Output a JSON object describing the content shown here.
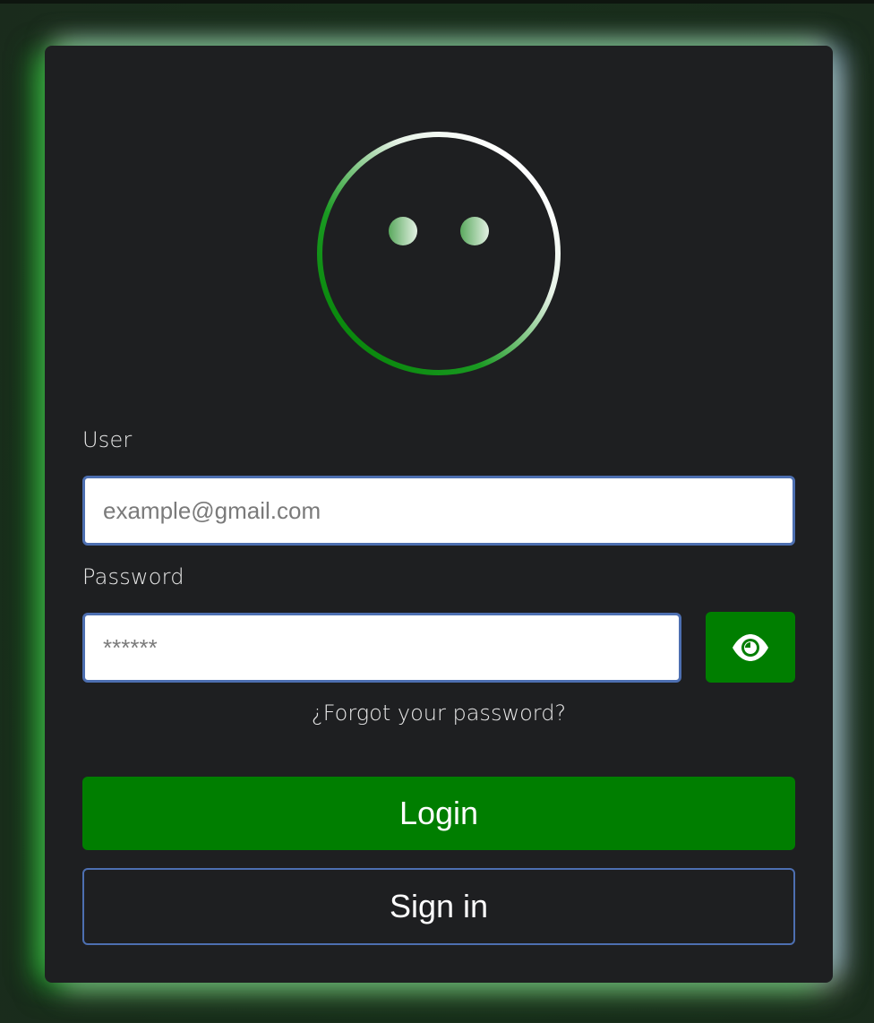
{
  "form": {
    "user_label": "User",
    "user_placeholder": "example@gmail.com",
    "user_value": "",
    "password_label": "Password",
    "password_placeholder": "******",
    "password_value": "",
    "forgot_link": "¿Forgot your password?",
    "login_label": "Login",
    "signin_label": "Sign in"
  },
  "icons": {
    "logo": "grimacing-face-icon",
    "toggle_password": "eye-icon"
  },
  "colors": {
    "accent_green": "#007e00",
    "input_border": "#4d6fb1",
    "card_background": "#1e1f21"
  }
}
